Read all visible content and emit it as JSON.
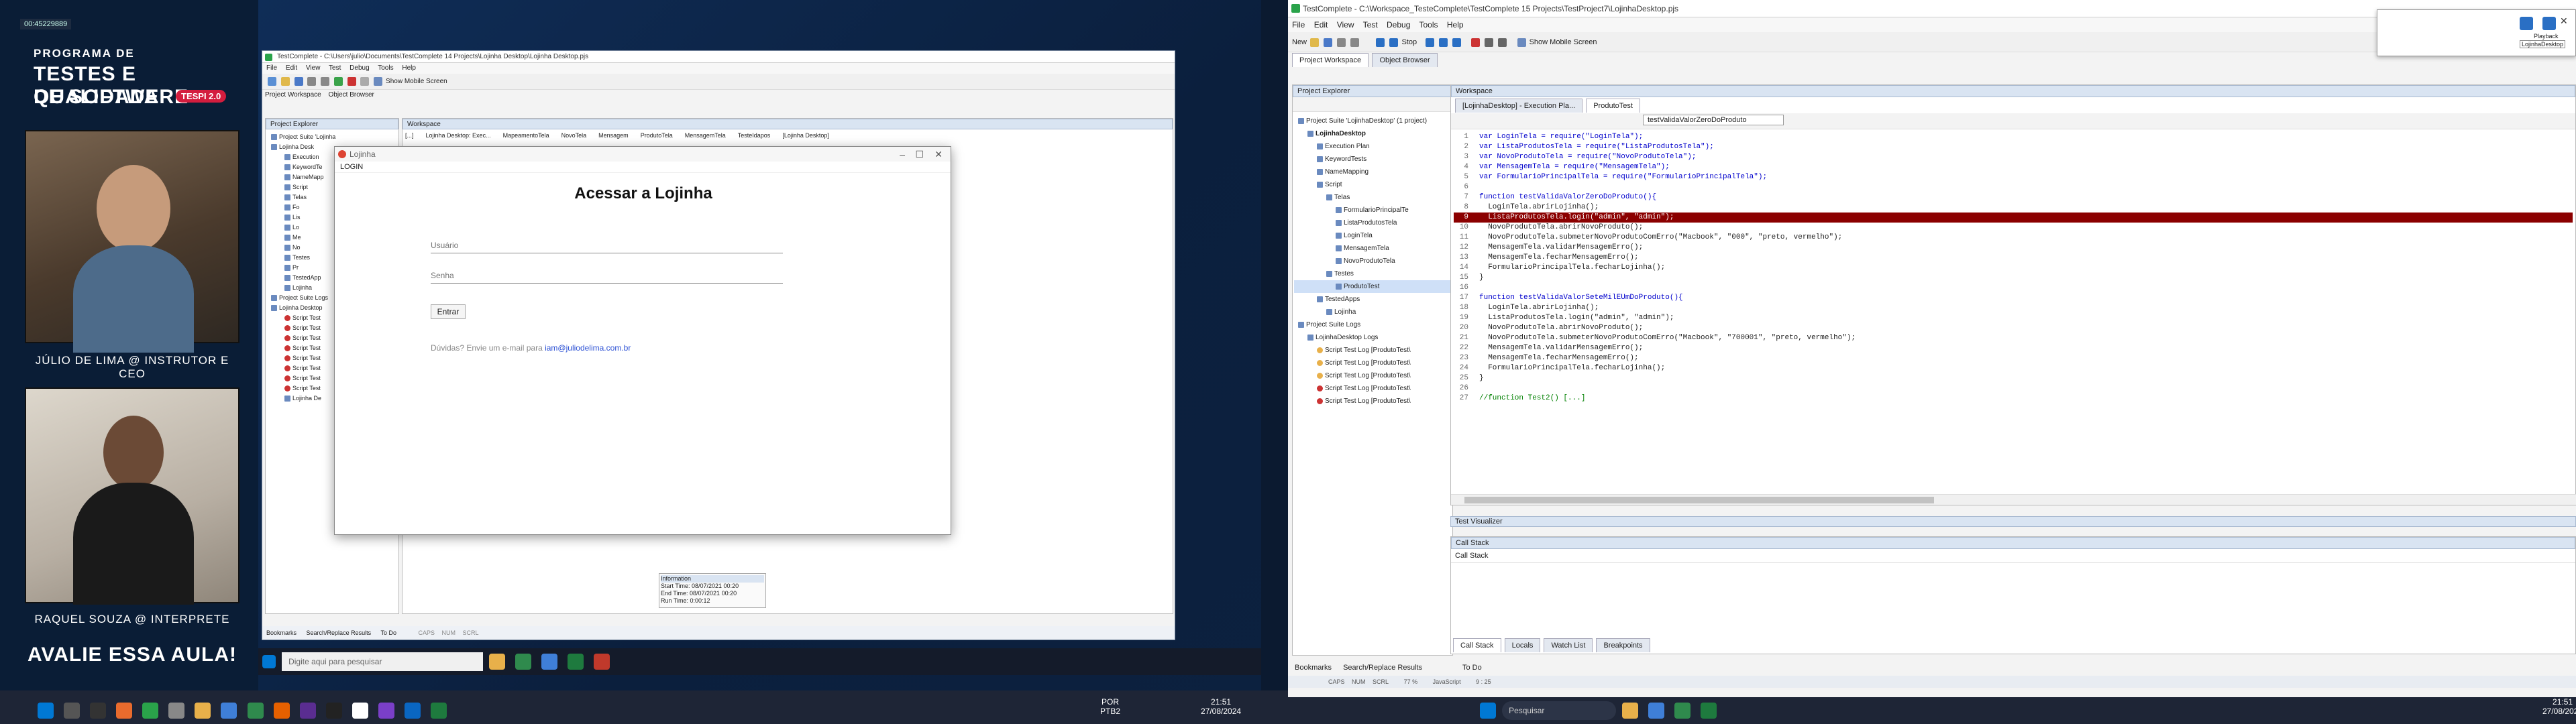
{
  "left_panel": {
    "timestamp": "00:45229889",
    "program": "PROGRAMA DE",
    "title_line1": "TESTES E QUALIDADE",
    "title_line2": "DE SOFTWARE",
    "badge": "TESPI 2.0",
    "instructor": "JÚLIO DE LIMA @ INSTRUTOR E CEO",
    "interpreter": "RAQUEL SOUZA @ INTERPRETE",
    "cta": "AVALIE ESSA AULA!"
  },
  "tc_left": {
    "title": "TestComplete - C:\\Users\\julio\\Documents\\TestComplete 14 Projects\\Lojinha Desktop\\Lojinha Desktop.pjs",
    "menu": [
      "File",
      "Edit",
      "View",
      "Test",
      "Debug",
      "Tools",
      "Help"
    ],
    "toolbar_label": "Show Mobile Screen",
    "tabs": [
      "Project Workspace",
      "Object Browser"
    ],
    "explorer_title": "Project Explorer",
    "workspace_title": "Workspace",
    "doc_tabs": [
      "[...]",
      "Lojinha Desktop: Exec...",
      "MapeamentoTela",
      "NovoTela",
      "Mensagem",
      "ProdutoTela",
      "MensagemTela",
      "TesteIdapos",
      "[Lojinha Desktop]"
    ],
    "tree": [
      "Project Suite 'Lojinha",
      "Lojinha Desk",
      "Execution",
      "KeywordTe",
      "NameMapp",
      "Script",
      "Telas",
      "Fo",
      "Lis",
      "Lo",
      "Me",
      "No",
      "Testes",
      "Pr",
      "TestedApp",
      "Lojinha",
      "Project Suite Logs",
      "Lojinha Desktop",
      "Script Test",
      "Script Test",
      "Script Test",
      "Script Test",
      "Script Test",
      "Script Test",
      "Script Test",
      "Script Test",
      "Lojinha De"
    ],
    "info_head": "Information",
    "info_start": "Start Time: 08/07/2021 00:20",
    "info_end": "End Time: 08/07/2021 00:20",
    "info_run": "Run Time: 0:00:12",
    "bottom_tabs": [
      "Bookmarks",
      "Search/Replace Results",
      "To Do"
    ],
    "status": [
      "CAPS",
      "NUM",
      "SCRL"
    ]
  },
  "login": {
    "window_title": "Lojinha",
    "heading": "LOGIN",
    "title": "Acessar a Lojinha",
    "user_placeholder": "Usuário",
    "pass_placeholder": "Senha",
    "button": "Entrar",
    "help_text": "Dúvidas? Envie um e-mail para",
    "help_email": "iam@juliodelima.com.br"
  },
  "taskbar_left": {
    "search_placeholder": "Digite aqui para pesquisar"
  },
  "tc_right": {
    "title": "TestComplete - C:\\Workspace_TesteComplete\\TestComplete 15 Projects\\TestProject7\\LojinhaDesktop.pjs",
    "menu": [
      "File",
      "Edit",
      "View",
      "Test",
      "Debug",
      "Tools",
      "Help"
    ],
    "new_label": "New",
    "stop_label": "Stop",
    "mobile_label": "Show Mobile Screen",
    "tabs": [
      "Project Workspace",
      "Object Browser"
    ],
    "explorer_title": "Project Explorer",
    "workspace_title": "Workspace",
    "doc_tabs": [
      "[LojinhaDesktop] - Execution Pla...",
      "ProdutoTest"
    ],
    "routine_select": "testValidaValorZeroDoProduto",
    "tree": [
      {
        "t": "Project Suite 'LojinhaDesktop' (1 project)",
        "d": 0
      },
      {
        "t": "LojinhaDesktop",
        "d": 1,
        "b": true
      },
      {
        "t": "Execution Plan",
        "d": 2
      },
      {
        "t": "KeywordTests",
        "d": 2
      },
      {
        "t": "NameMapping",
        "d": 2
      },
      {
        "t": "Script",
        "d": 2
      },
      {
        "t": "Telas",
        "d": 3
      },
      {
        "t": "FormularioPrincipalTe",
        "d": 4
      },
      {
        "t": "ListaProdutosTela",
        "d": 4
      },
      {
        "t": "LoginTela",
        "d": 4
      },
      {
        "t": "MensagemTela",
        "d": 4
      },
      {
        "t": "NovoProdutoTela",
        "d": 4
      },
      {
        "t": "Testes",
        "d": 3
      },
      {
        "t": "ProdutoTest",
        "d": 4,
        "sel": true
      },
      {
        "t": "TestedApps",
        "d": 2
      },
      {
        "t": "Lojinha",
        "d": 3
      },
      {
        "t": "Project Suite Logs",
        "d": 0
      },
      {
        "t": "LojinhaDesktop Logs",
        "d": 1
      },
      {
        "t": "Script Test Log [ProdutoTest\\",
        "d": 2
      },
      {
        "t": "Script Test Log [ProdutoTest\\",
        "d": 2
      },
      {
        "t": "Script Test Log [ProdutoTest\\",
        "d": 2
      },
      {
        "t": "Script Test Log [ProdutoTest\\",
        "d": 2
      },
      {
        "t": "Script Test Log [ProdutoTest\\",
        "d": 2
      }
    ],
    "code": [
      "var LoginTela = require(\"LoginTela\");",
      "var ListaProdutosTela = require(\"ListaProdutosTela\");",
      "var NovoProdutoTela = require(\"NovoProdutoTela\");",
      "var MensagemTela = require(\"MensagemTela\");",
      "var FormularioPrincipalTela = require(\"FormularioPrincipalTela\");",
      "",
      "function testValidaValorZeroDoProduto(){",
      "  LoginTela.abrirLojinha();",
      "  ListaProdutosTela.login(\"admin\", \"admin\");",
      "  NovoProdutoTela.abrirNovoProduto();",
      "  NovoProdutoTela.submeterNovoProdutoComErro(\"Macbook\", \"000\", \"preto, vermelho\");",
      "  MensagemTela.validarMensagemErro();",
      "  MensagemTela.fecharMensagemErro();",
      "  FormularioPrincipalTela.fecharLojinha();",
      "}",
      "",
      "function testValidaValorSeteMilEUmDoProduto(){",
      "  LoginTela.abrirLojinha();",
      "  ListaProdutosTela.login(\"admin\", \"admin\");",
      "  NovoProdutoTela.abrirNovoProduto();",
      "  NovoProdutoTela.submeterNovoProdutoComErro(\"Macbook\", \"700001\", \"preto, vermelho\");",
      "  MensagemTela.validarMensagemErro();",
      "  MensagemTela.fecharMensagemErro();",
      "  FormularioPrincipalTela.fecharLojinha();",
      "}",
      "",
      "//function Test2() [...]"
    ],
    "error_line": 9,
    "visualizer": "Test Visualizer",
    "callstack_head": "Call Stack",
    "callstack_col": "Call Stack",
    "bottom_tabs": [
      "Call Stack",
      "Locals",
      "Watch List",
      "Breakpoints"
    ],
    "left_bottom_tabs": [
      "Bookmarks",
      "Search/Replace Results",
      "To Do"
    ],
    "status": [
      "CAPS",
      "NUM",
      "SCRL",
      "77 %",
      "JavaScript",
      "9 : 25"
    ],
    "playback_label": "Playback",
    "playback_app": "LojinhaDesktop"
  },
  "taskbar_right": {
    "search_placeholder": "Pesquisar"
  },
  "clock_left": {
    "lang1": "POR",
    "lang2": "PTB2",
    "time": "21:51",
    "date": "27/08/2024"
  },
  "clock_right": {
    "time": "21:51",
    "date": "27/08/2024"
  },
  "colors": {
    "accent": "#2a6fc4",
    "error": "#8b0000",
    "brand_red": "#d41d3e"
  }
}
